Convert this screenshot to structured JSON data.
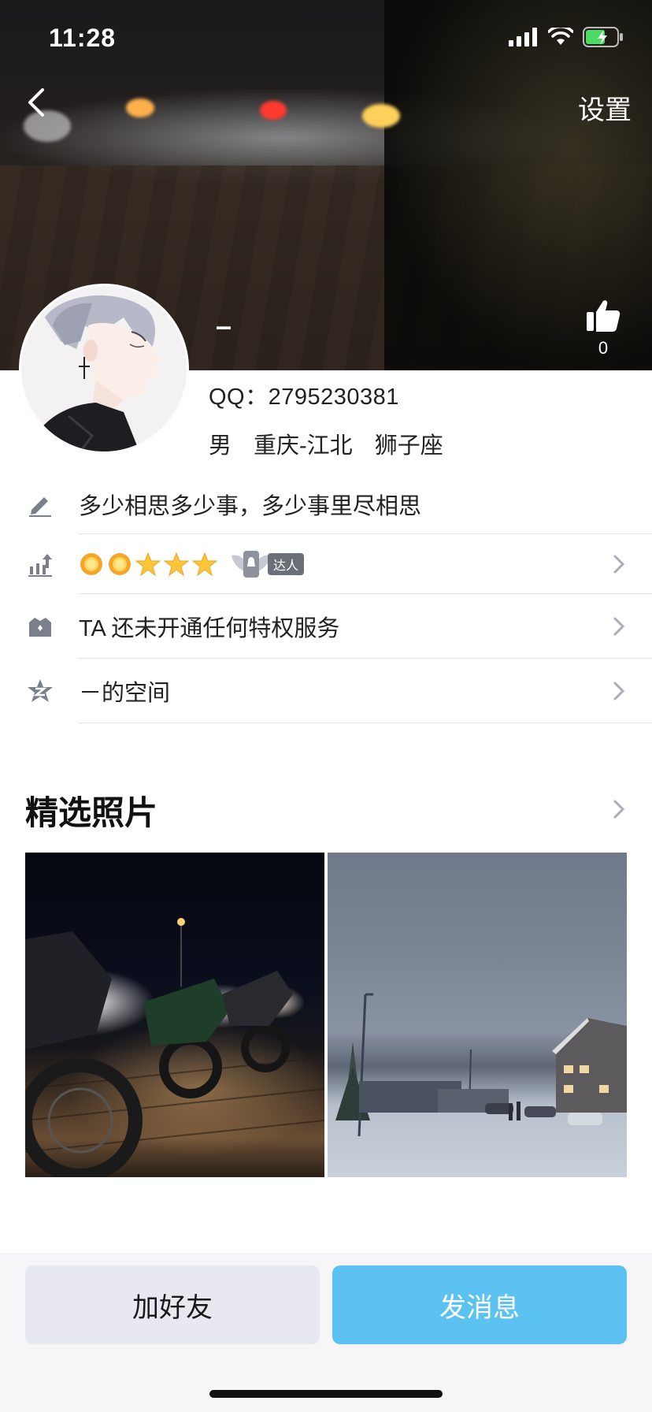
{
  "status_bar": {
    "time": "11:28",
    "icons": [
      "signal-icon",
      "wifi-icon",
      "battery-charging-icon"
    ]
  },
  "header": {
    "back_icon": "chevron-left-icon",
    "settings_label": "设置",
    "nickname": "–",
    "like_icon": "thumbs-up-icon",
    "like_count": "0"
  },
  "profile": {
    "qq_label": "QQ：2795230381",
    "gender": "男",
    "location": "重庆-江北",
    "zodiac": "狮子座"
  },
  "rows": [
    {
      "icon": "pencil-icon",
      "text": "多少相思多少事，多少事里尽相思",
      "has_chevron": false
    },
    {
      "icon": "level-up-icon",
      "text": "",
      "level_icons": [
        "sun-icon",
        "sun-icon",
        "star-icon",
        "star-icon",
        "star-icon"
      ],
      "badge_text": "达人",
      "has_chevron": true
    },
    {
      "icon": "crown-icon",
      "text": "TA 还未开通任何特权服务",
      "has_chevron": true
    },
    {
      "icon": "qzone-star-icon",
      "text": "－的空间",
      "has_chevron": true
    }
  ],
  "featured": {
    "title": "精选照片",
    "photos": [
      "motorcycles-night-photo",
      "snowy-street-photo"
    ]
  },
  "actions": {
    "add_friend": "加好友",
    "send_message": "发消息"
  },
  "colors": {
    "accent_blue": "#5cc2f2",
    "secondary_button": "#e8e8f0",
    "icon_gray": "#7a7f8c"
  }
}
